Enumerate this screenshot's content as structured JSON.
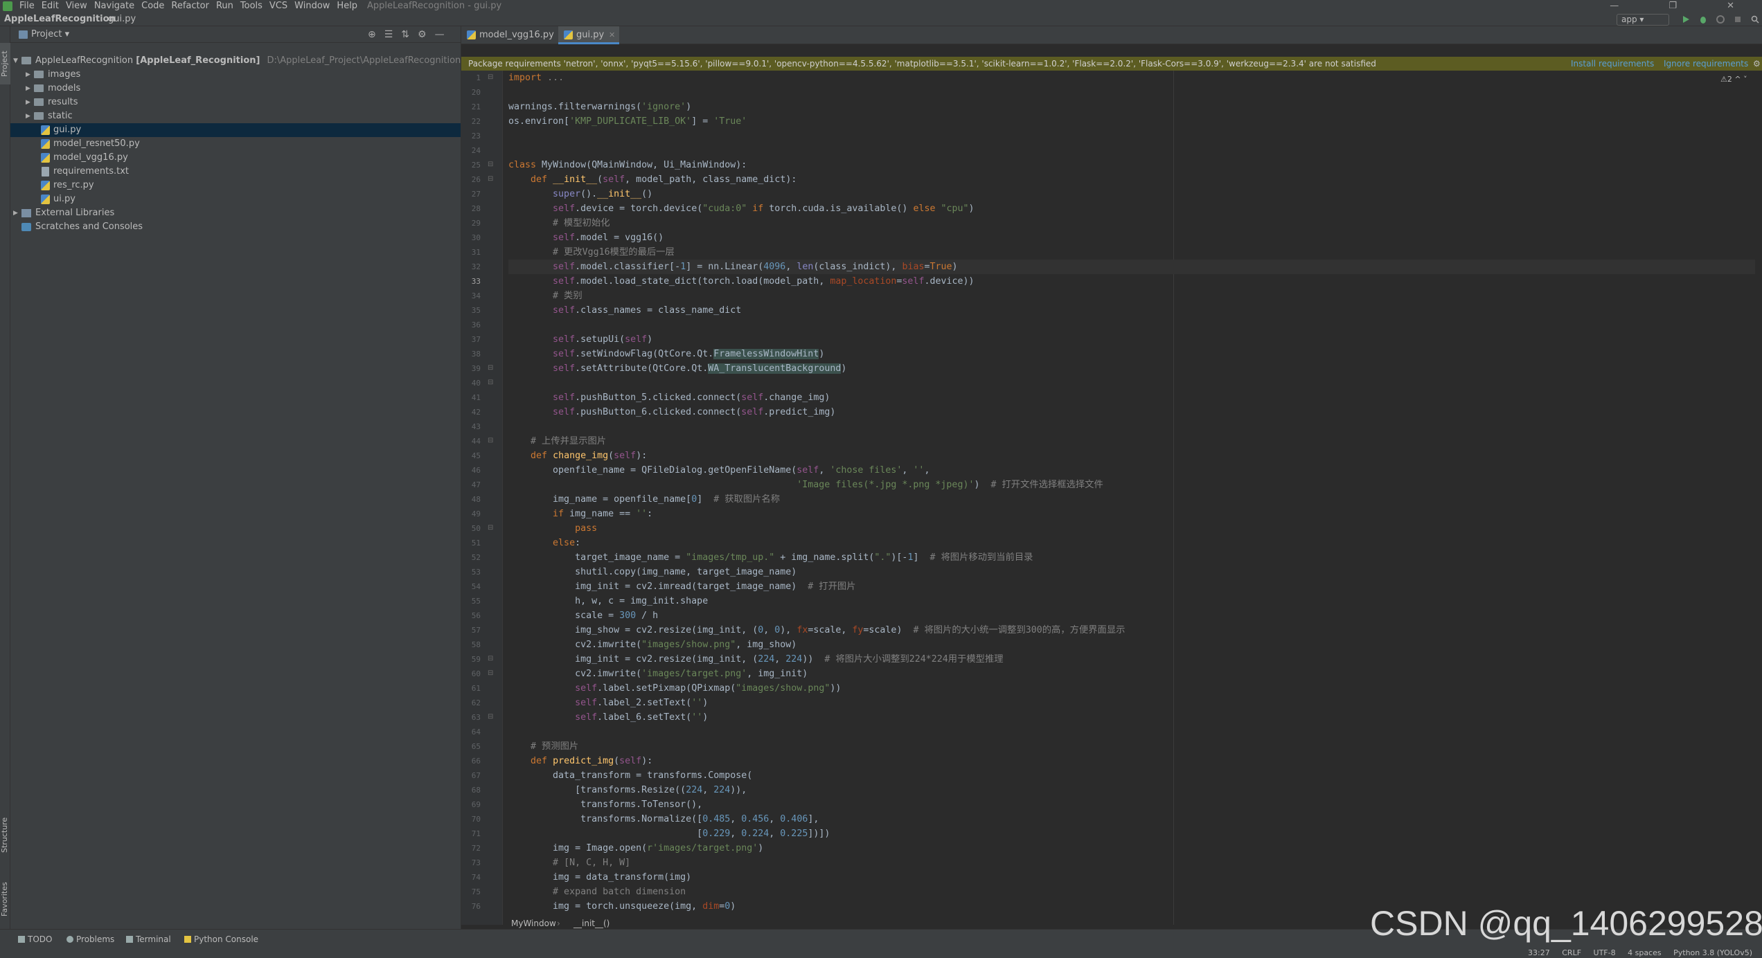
{
  "menubar": {
    "items": [
      "File",
      "Edit",
      "View",
      "Navigate",
      "Code",
      "Refactor",
      "Run",
      "Tools",
      "VCS",
      "Window",
      "Help"
    ],
    "window_title": "AppleLeafRecognition - gui.py",
    "controls": "— ❐ ✕"
  },
  "navbar": {
    "project": "AppleLeafRecognition",
    "file": "gui.py",
    "run_config": "app"
  },
  "sidebar_tabs": {
    "project": "Project",
    "structure": "Structure",
    "favorites": "Favorites"
  },
  "project_panel": {
    "title": "Project",
    "root": {
      "name": "AppleLeafRecognition",
      "module": "[AppleLeaf_Recognition]",
      "path": "D:\\AppleLeaf_Project\\AppleLeafRecognition"
    },
    "folders": [
      "images",
      "models",
      "results",
      "static"
    ],
    "files": [
      "gui.py",
      "model_resnet50.py",
      "model_vgg16.py",
      "requirements.txt",
      "res_rc.py",
      "ui.py"
    ],
    "external_libraries": "External Libraries",
    "scratches": "Scratches and Consoles"
  },
  "tabs": [
    {
      "label": "model_vgg16.py"
    },
    {
      "label": "gui.py"
    }
  ],
  "notice": {
    "text": "Package requirements 'netron', 'onnx', 'pyqt5==5.15.6', 'pillow==9.0.1', 'opencv-python==4.5.5.62', 'matplotlib==3.5.1', 'scikit-learn==1.0.2', 'Flask==2.0.2', 'Flask-Cors==3.0.9', 'werkzeug==2.3.4' are not satisfied",
    "install": "Install requirements",
    "ignore": "Ignore requirements"
  },
  "editor": {
    "warning_count": "⚠2 ^ ˅",
    "current_line": "33",
    "line_numbers": [
      "1",
      "20",
      "21",
      "22",
      "23",
      "24",
      "25",
      "26",
      "27",
      "28",
      "29",
      "30",
      "31",
      "32",
      "33",
      "34",
      "35",
      "36",
      "37",
      "38",
      "39",
      "40",
      "41",
      "42",
      "43",
      "44",
      "45",
      "46",
      "47",
      "48",
      "49",
      "50",
      "51",
      "52",
      "53",
      "54",
      "55",
      "56",
      "57",
      "58",
      "59",
      "60",
      "61",
      "62",
      "63",
      "64",
      "65",
      "66",
      "67",
      "68",
      "69",
      "70",
      "71",
      "72",
      "73",
      "74",
      "75",
      "76"
    ],
    "breadcrumb": {
      "class": "MyWindow",
      "method": "__init__()"
    }
  },
  "tool_windows": [
    "TODO",
    "Problems",
    "Terminal",
    "Python Console"
  ],
  "status": {
    "position": "33:27",
    "line_sep": "CRLF",
    "encoding": "UTF-8",
    "indent": "4 spaces",
    "interpreter": "Python 3.8 (YOLOv5)"
  },
  "watermark": "CSDN @qq_1406299528"
}
